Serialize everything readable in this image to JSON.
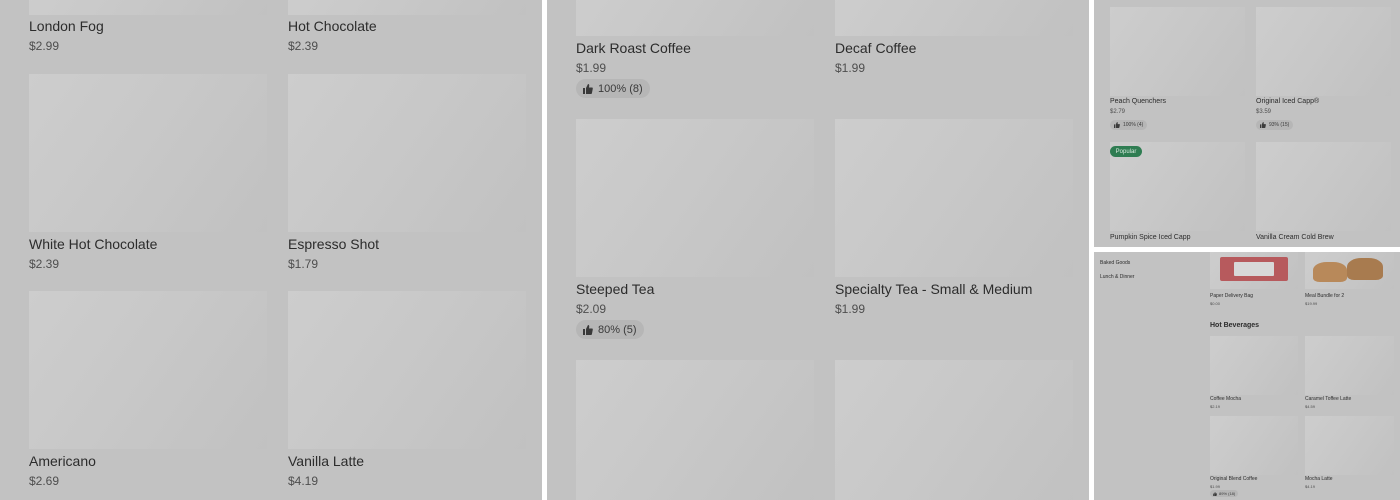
{
  "panel1": {
    "items": [
      {
        "name": "London Fog",
        "price": "$2.99"
      },
      {
        "name": "Hot Chocolate",
        "price": "$2.39"
      },
      {
        "name": "White Hot Chocolate",
        "price": "$2.39"
      },
      {
        "name": "Espresso Shot",
        "price": "$1.79"
      },
      {
        "name": "Americano",
        "price": "$2.69"
      },
      {
        "name": "Vanilla Latte",
        "price": "$4.19"
      }
    ]
  },
  "panel2": {
    "items": [
      {
        "name": "Dark Roast Coffee",
        "price": "$1.99",
        "rating": "100% (8)"
      },
      {
        "name": "Decaf Coffee",
        "price": "$1.99"
      },
      {
        "name": "Steeped Tea",
        "price": "$2.09",
        "rating": "80% (5)"
      },
      {
        "name": "Specialty Tea - Small & Medium",
        "price": "$1.99"
      }
    ]
  },
  "panel3": {
    "items": [
      {
        "name": "Peach Quenchers",
        "price": "$2.79",
        "rating": "100% (4)"
      },
      {
        "name": "Original Iced Capp®",
        "price": "$3.59",
        "rating": "93% (15)"
      },
      {
        "name": "Pumpkin Spice Iced Capp",
        "badge": "Popular"
      },
      {
        "name": "Vanilla Cream Cold Brew"
      }
    ]
  },
  "panel4": {
    "sidebar": [
      "Baked Goods",
      "Lunch & Dinner"
    ],
    "top_items": [
      {
        "name": "Paper Delivery Bag",
        "price": "$0.00"
      },
      {
        "name": "Meal Bundle for 2",
        "price": "$19.99"
      }
    ],
    "section_title": "Hot Beverages",
    "items": [
      {
        "name": "Coffee Mocha",
        "price": "$2.19"
      },
      {
        "name": "Caramel Toffee Latte",
        "price": "$4.59"
      },
      {
        "name": "Original Blend Coffee",
        "price": "$1.99",
        "rating": "89% (18)"
      },
      {
        "name": "Mocha Latte",
        "price": "$4.19"
      }
    ]
  },
  "colors": {
    "overlay": "#c2c2c2",
    "popular_badge": "#2f7d52",
    "text": "#2c2c2c"
  }
}
